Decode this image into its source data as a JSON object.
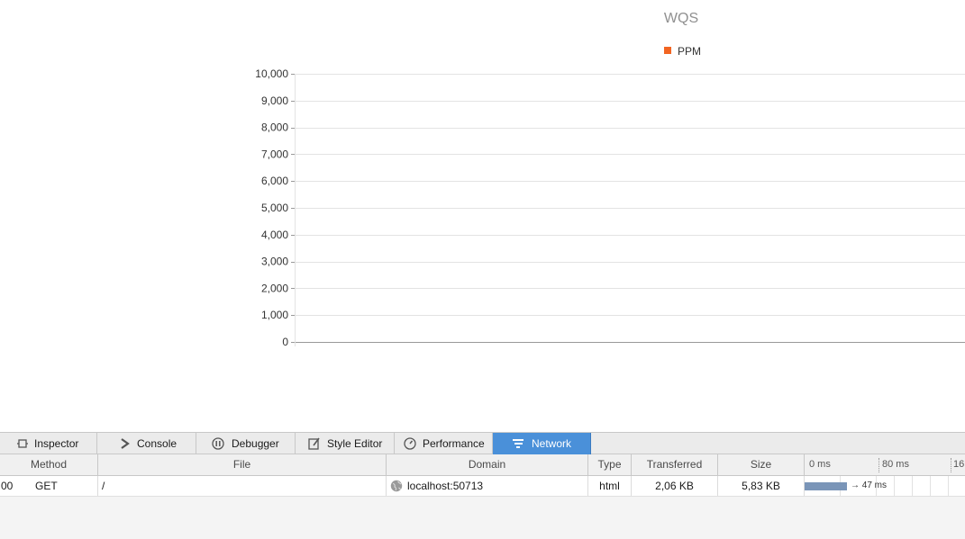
{
  "chart": {
    "title": "WQS",
    "legend": {
      "label": "PPM",
      "color": "#f26522"
    },
    "gridline_color": "#e3e3e3",
    "axis_color": "#999999"
  },
  "chart_data": {
    "type": "line",
    "title": "WQS",
    "series": [
      {
        "name": "PPM",
        "values": []
      }
    ],
    "ylim": [
      0,
      10000
    ],
    "yticks": [
      "10,000",
      "9,000",
      "8,000",
      "7,000",
      "6,000",
      "5,000",
      "4,000",
      "3,000",
      "2,000",
      "1,000",
      "0"
    ],
    "grid": true,
    "legend_position": "top"
  },
  "devtools": {
    "tabs": [
      {
        "label": "Inspector",
        "icon": "inspector-icon",
        "active": false
      },
      {
        "label": "Console",
        "icon": "console-icon",
        "active": false
      },
      {
        "label": "Debugger",
        "icon": "debugger-icon",
        "active": false
      },
      {
        "label": "Style Editor",
        "icon": "style-editor-icon",
        "active": false
      },
      {
        "label": "Performance",
        "icon": "performance-icon",
        "active": false
      },
      {
        "label": "Network",
        "icon": "network-icon",
        "active": true
      }
    ],
    "network": {
      "columns": {
        "method": "Method",
        "file": "File",
        "domain": "Domain",
        "type": "Type",
        "transferred": "Transferred",
        "size": "Size"
      },
      "timeline_ticks": [
        "0 ms",
        "80 ms",
        "16"
      ],
      "rows": [
        {
          "status": "00",
          "method": "GET",
          "file": "/",
          "domain": "localhost:50713",
          "domain_icon": "globe-icon",
          "type": "html",
          "transferred": "2,06 KB",
          "size": "5,83 KB",
          "timing": "→ 47 ms",
          "timing_ms": 47
        }
      ]
    }
  }
}
